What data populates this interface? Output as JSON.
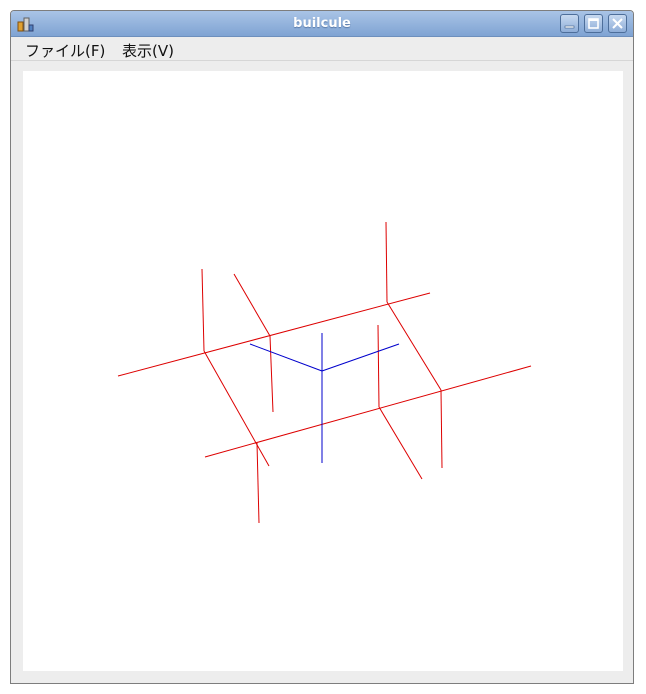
{
  "window": {
    "title": "builcule"
  },
  "menu": {
    "file": "ファイル(F)",
    "view": "表示(V)"
  },
  "colors": {
    "bonds": "#dd0000",
    "axes": "#0000cc",
    "titlebar": "#8eadd8"
  },
  "icons": [
    "app-icon",
    "minimize-icon",
    "maximize-icon",
    "close-icon"
  ]
}
